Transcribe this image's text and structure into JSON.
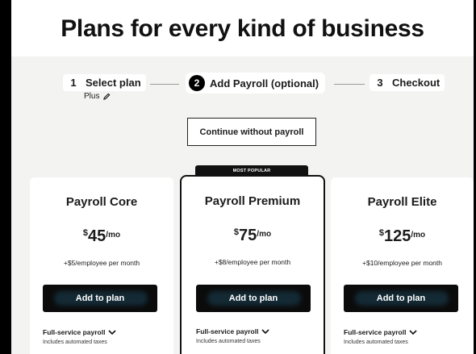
{
  "header": {
    "title": "Plans for every kind of business"
  },
  "steps": [
    {
      "number": "1",
      "label": "Select plan",
      "sub": "Plus"
    },
    {
      "number": "2",
      "label": "Add Payroll (optional)"
    },
    {
      "number": "3",
      "label": "Checkout"
    }
  ],
  "continue_label": "Continue without payroll",
  "badge": "MOST POPULAR",
  "plans": [
    {
      "name": "Payroll Core",
      "currency": "$",
      "amount": "45",
      "period": "/mo",
      "note": "+$5/employee per month",
      "button": "Add to plan",
      "feature": "Full-service payroll",
      "feature_sub": "Includes automated taxes"
    },
    {
      "name": "Payroll Premium",
      "currency": "$",
      "amount": "75",
      "period": "/mo",
      "note": "+$8/employee per month",
      "button": "Add to plan",
      "feature": "Full-service payroll",
      "feature_sub": "Includes automated taxes"
    },
    {
      "name": "Payroll Elite",
      "currency": "$",
      "amount": "125",
      "period": "/mo",
      "note": "+$10/employee per month",
      "button": "Add to plan",
      "feature": "Full-service payroll",
      "feature_sub": "Includes automated taxes"
    }
  ],
  "icons": {
    "edit": "pencil-icon",
    "expand": "chevron-down-icon"
  }
}
